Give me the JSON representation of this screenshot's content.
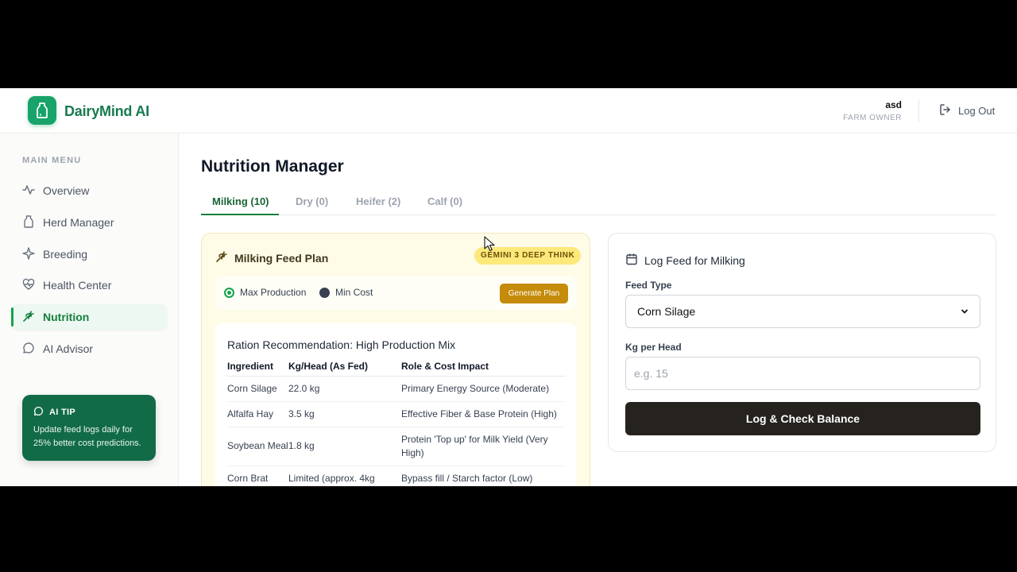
{
  "app": {
    "brand": "DairyMind AI"
  },
  "user": {
    "name": "asd",
    "role": "FARM OWNER"
  },
  "header": {
    "logout_label": "Log Out"
  },
  "sidebar": {
    "title": "MAIN MENU",
    "items": [
      {
        "label": "Overview",
        "icon": "activity-icon"
      },
      {
        "label": "Herd Manager",
        "icon": "milk-bottle-icon"
      },
      {
        "label": "Breeding",
        "icon": "sparkle-icon"
      },
      {
        "label": "Health Center",
        "icon": "heart-pulse-icon"
      },
      {
        "label": "Nutrition",
        "icon": "wheat-icon",
        "active": true
      },
      {
        "label": "AI Advisor",
        "icon": "chat-bubble-icon"
      }
    ],
    "tip": {
      "title": "AI TIP",
      "body": "Update feed logs daily for 25% better cost predictions."
    }
  },
  "main": {
    "title": "Nutrition Manager",
    "tabs": [
      {
        "label": "Milking (10)",
        "active": true
      },
      {
        "label": "Dry (0)"
      },
      {
        "label": "Heifer (2)"
      },
      {
        "label": "Calf (0)"
      }
    ]
  },
  "plan": {
    "title": "Milking Feed Plan",
    "badge": "GEMINI 3 DEEP THINK",
    "options": [
      {
        "label": "Max Production",
        "selected": true
      },
      {
        "label": "Min Cost",
        "selected": false
      }
    ],
    "generate_label": "Generate Plan",
    "ration_title": "Ration Recommendation: High Production Mix",
    "columns": [
      "Ingredient",
      "Kg/Head (As Fed)",
      "Role & Cost Impact"
    ],
    "rows": [
      [
        "Corn Silage",
        "22.0 kg",
        "Primary Energy Source (Moderate)"
      ],
      [
        "Alfalfa Hay",
        "3.5 kg",
        "Effective Fiber & Base Protein (High)"
      ],
      [
        "Soybean Meal",
        "1.8 kg",
        "Protein 'Top up' for Milk Yield (Very High)"
      ],
      [
        "Corn Brat",
        "Limited (approx. 4kg",
        "Bypass fill / Starch factor (Low)"
      ]
    ]
  },
  "log": {
    "title": "Log Feed for Milking",
    "feed_type_label": "Feed Type",
    "feed_type_value": "Corn Silage",
    "kg_label": "Kg per Head",
    "kg_placeholder": "e.g. 15",
    "submit_label": "Log & Check Balance"
  },
  "colors": {
    "brand": "#17a36a",
    "sidebar_active": "#15803d",
    "tip_bg": "#126b47",
    "generate_btn": "#c58b0b",
    "badge_bg": "#fbe97b",
    "log_btn": "#26221e"
  }
}
